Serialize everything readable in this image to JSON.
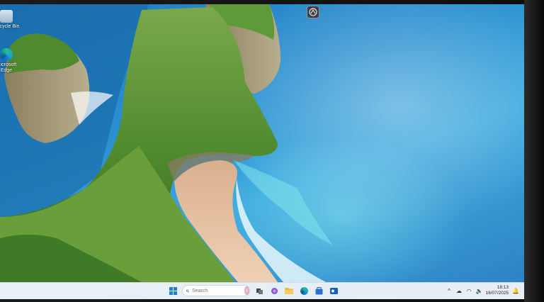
{
  "desktop": {
    "icons": [
      {
        "name": "Recycle Bin",
        "label": "Recycle Bin",
        "icon": "recycle-bin-icon"
      },
      {
        "name": "Microsoft Edge",
        "label": "Microsoft Edge",
        "icon": "edge-icon"
      },
      {
        "name": "App shortcut",
        "label": "",
        "icon": "app-shortcut-icon"
      }
    ]
  },
  "taskbar": {
    "search_placeholder": "Search",
    "apps": [
      {
        "name": "start",
        "icon": "windows-start-icon",
        "color": "#1e7fd6"
      },
      {
        "name": "widgets",
        "icon": "widgets-icon",
        "color": "#d9a7b8"
      },
      {
        "name": "task-view",
        "icon": "task-view-icon",
        "color": "#444444"
      },
      {
        "name": "copilot",
        "icon": "copilot-icon",
        "color": "#6d5cf0"
      },
      {
        "name": "file-explorer",
        "icon": "folder-icon",
        "color": "#f3b83a"
      },
      {
        "name": "edge",
        "icon": "edge-icon",
        "color": "#1c9bd8"
      },
      {
        "name": "store",
        "icon": "store-icon",
        "color": "#2d6fd8"
      },
      {
        "name": "outlook",
        "icon": "outlook-icon",
        "color": "#0f62c4"
      }
    ]
  },
  "tray": {
    "time": "18:13",
    "date": "16/07/2025"
  },
  "colors": {
    "sea": "#2a8fd0",
    "cliff_green": "#5e9a36",
    "sand": "#e8c2a0",
    "taskbar": "#eef2f8"
  }
}
